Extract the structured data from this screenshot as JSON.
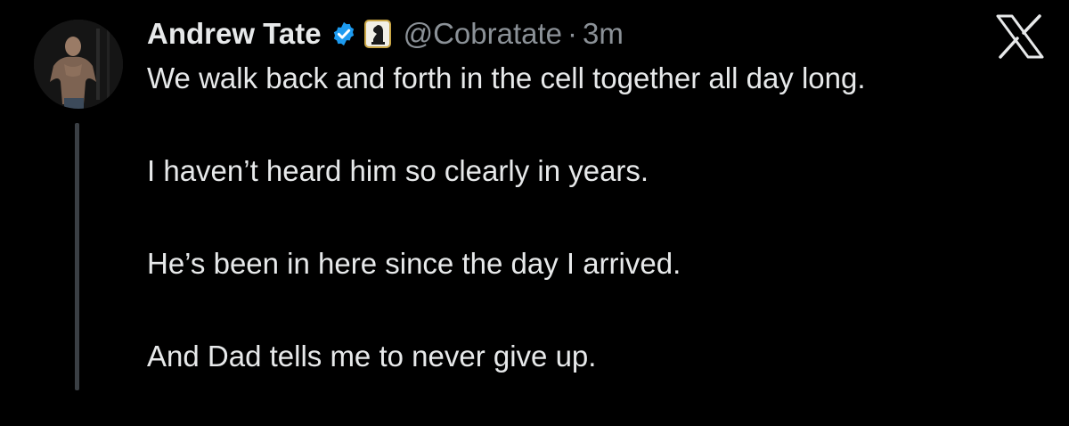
{
  "tweet": {
    "author": {
      "display_name": "Andrew Tate",
      "handle": "@Cobratate",
      "verified": true,
      "affiliate_badge_icon": "chess-knight-icon"
    },
    "separator": "·",
    "timestamp": "3m",
    "paragraphs": [
      "We walk back and forth in the cell together all day long.",
      "I haven’t heard him so clearly in years.",
      "He’s been in here since the day I arrived.",
      "And Dad tells me to never give up."
    ]
  },
  "brand": {
    "logo_icon": "x-logo-icon"
  },
  "colors": {
    "background": "#000000",
    "primary_text": "#e7e9ea",
    "secondary_text": "#8b9197",
    "verified_blue": "#1d9bf0",
    "affiliate_gold": "#c9a646",
    "thread_line": "#3a3f44"
  }
}
